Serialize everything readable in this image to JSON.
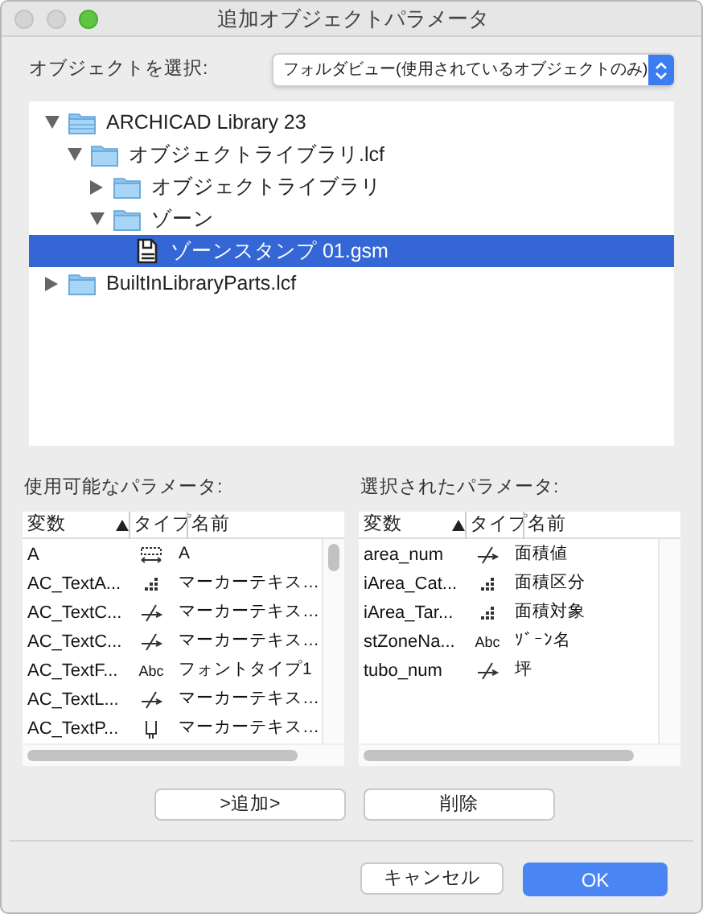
{
  "window": {
    "title": "追加オブジェクトパラメータ"
  },
  "object_select": {
    "label": "オブジェクトを選択:",
    "value": "フォルダビュー(使用されているオブジェクトのみ)"
  },
  "tree": [
    {
      "label": "ARCHICAD Library 23",
      "kind": "library",
      "expanded": true,
      "selected": false,
      "children": [
        {
          "label": "オブジェクトライブラリ.lcf",
          "kind": "folder",
          "expanded": true,
          "selected": false,
          "children": [
            {
              "label": "オブジェクトライブラリ",
              "kind": "folder",
              "expanded": false,
              "selected": false
            },
            {
              "label": "ゾーン",
              "kind": "folder",
              "expanded": true,
              "selected": false,
              "children": [
                {
                  "label": "ゾーンスタンプ 01.gsm",
                  "kind": "object",
                  "selected": true
                }
              ]
            }
          ]
        }
      ]
    },
    {
      "label": "BuiltInLibraryParts.lcf",
      "kind": "folder",
      "expanded": false,
      "selected": false
    }
  ],
  "available": {
    "label": "使用可能なパラメータ:",
    "columns": [
      "変数",
      "タイプ",
      "名前"
    ],
    "rows": [
      {
        "variable": "A",
        "type": {
          "kind": "length"
        },
        "name": "A"
      },
      {
        "variable": "AC_TextA...",
        "type": {
          "kind": "integer"
        },
        "name": "マーカーテキス…"
      },
      {
        "variable": "AC_TextC...",
        "type": {
          "kind": "angle"
        },
        "name": "マーカーテキス…"
      },
      {
        "variable": "AC_TextC...",
        "type": {
          "kind": "angle"
        },
        "name": "マーカーテキス…"
      },
      {
        "variable": "AC_TextF...",
        "type": {
          "kind": "text",
          "label": "Abc"
        },
        "name": "フォントタイプ1"
      },
      {
        "variable": "AC_TextL...",
        "type": {
          "kind": "angle"
        },
        "name": "マーカーテキス…"
      },
      {
        "variable": "AC_TextP...",
        "type": {
          "kind": "pen"
        },
        "name": "マーカーテキス…"
      }
    ]
  },
  "selected": {
    "label": "選択されたパラメータ:",
    "columns": [
      "変数",
      "タイプ",
      "名前"
    ],
    "rows": [
      {
        "variable": "area_num",
        "type": {
          "kind": "angle"
        },
        "name": "面積値"
      },
      {
        "variable": "iArea_Cat...",
        "type": {
          "kind": "integer"
        },
        "name": "面積区分"
      },
      {
        "variable": "iArea_Tar...",
        "type": {
          "kind": "integer"
        },
        "name": "面積対象"
      },
      {
        "variable": "stZoneNa...",
        "type": {
          "kind": "text",
          "label": "Abc"
        },
        "name": "ｿﾞｰﾝ名"
      },
      {
        "variable": "tubo_num",
        "type": {
          "kind": "angle"
        },
        "name": "坪"
      }
    ]
  },
  "buttons": {
    "add": ">追加>",
    "remove": "削除",
    "cancel": "キャンセル",
    "ok": "OK"
  }
}
